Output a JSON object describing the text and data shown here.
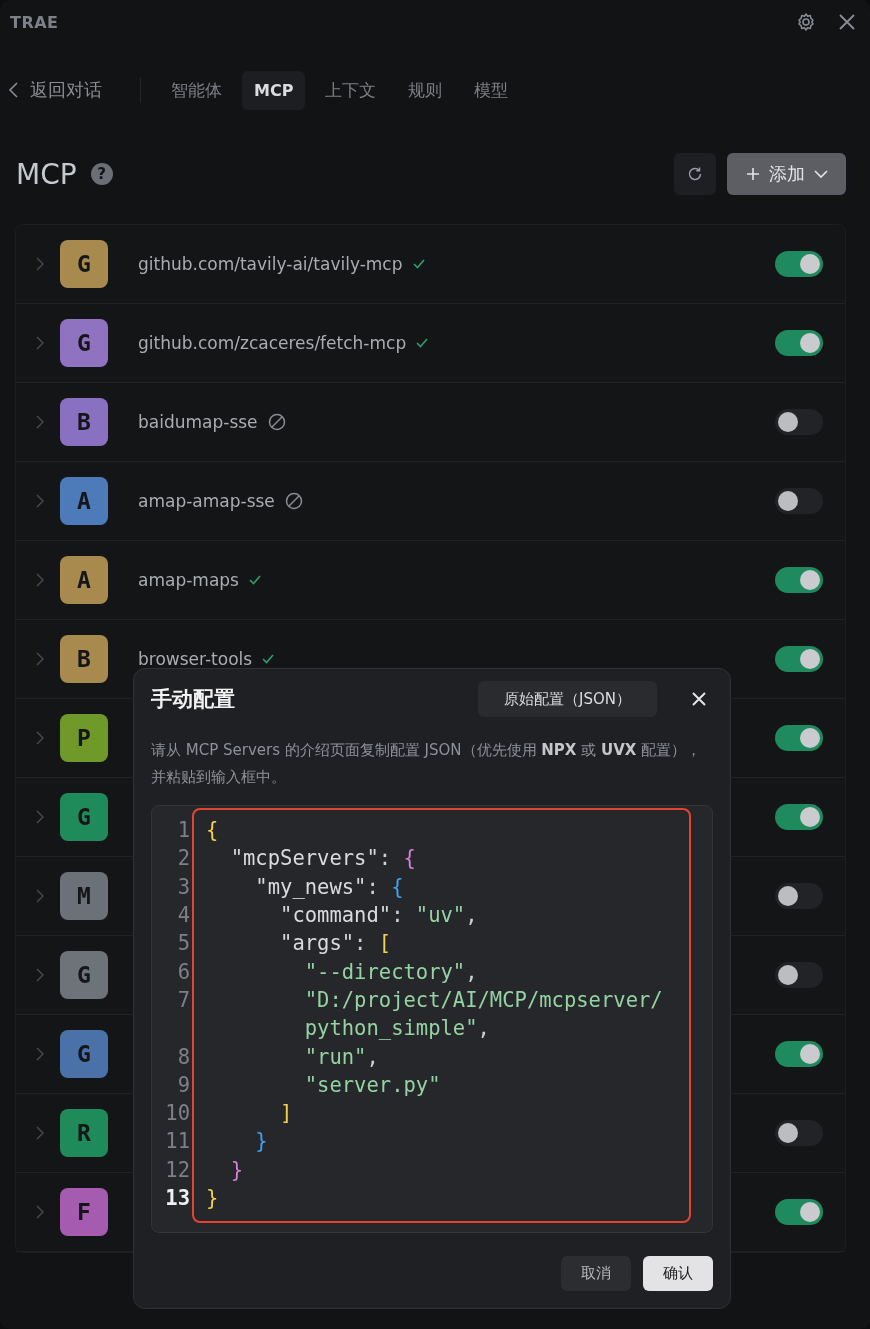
{
  "window": {
    "title": "TRAE"
  },
  "nav": {
    "back": "返回对话",
    "tabs": [
      {
        "label": "智能体",
        "selected": false
      },
      {
        "label": "MCP",
        "selected": true
      },
      {
        "label": "上下文",
        "selected": false
      },
      {
        "label": "规则",
        "selected": false
      },
      {
        "label": "模型",
        "selected": false
      }
    ]
  },
  "header": {
    "title": "MCP",
    "help": "?",
    "add_button": "添加"
  },
  "servers": [
    {
      "letter": "G",
      "color": "#a98a4e",
      "name": "github.com/tavily-ai/tavily-mcp",
      "verified": true,
      "on": true
    },
    {
      "letter": "G",
      "color": "#8f72c0",
      "name": "github.com/zcaceres/fetch-mcp",
      "verified": true,
      "on": true
    },
    {
      "letter": "B",
      "color": "#8a70c0",
      "name": "baidumap-sse",
      "verified": false,
      "on": false
    },
    {
      "letter": "A",
      "color": "#4d7ab8",
      "name": "amap-amap-sse",
      "verified": false,
      "on": false
    },
    {
      "letter": "A",
      "color": "#a98a4e",
      "name": "amap-maps",
      "verified": true,
      "on": true
    },
    {
      "letter": "B",
      "color": "#a98a4e",
      "name": "browser-tools",
      "verified": true,
      "on": true
    },
    {
      "letter": "P",
      "color": "#6f9a2a",
      "on": true
    },
    {
      "letter": "G",
      "color": "#1f8a5a",
      "on": true
    },
    {
      "letter": "M",
      "color": "#6c7078",
      "on": false
    },
    {
      "letter": "G",
      "color": "#6e7279",
      "on": false
    },
    {
      "letter": "G",
      "color": "#4a72a8",
      "on": true
    },
    {
      "letter": "R",
      "color": "#1f8a5a",
      "on": false
    },
    {
      "letter": "F",
      "color": "#a55cb0",
      "on": true
    }
  ],
  "dialog": {
    "title": "手动配置",
    "raw_button": "原始配置（JSON）",
    "description": "请从 MCP Servers 的介绍页面复制配置 JSON（优先使用 **NPX** 或 **UVX** 配置），并粘贴到输入框中。",
    "code": [
      {
        "number": "1",
        "active": false,
        "tokens": [
          {
            "t": "{",
            "kind": "bracket",
            "color": "#f2d24b"
          }
        ]
      },
      {
        "number": "2",
        "active": false,
        "tokens": [
          {
            "t": "  \"mcpServers\"",
            "kind": "key"
          },
          {
            "t": ": ",
            "kind": "punct"
          },
          {
            "t": "{",
            "kind": "bracket",
            "color": "#d67fd8"
          }
        ]
      },
      {
        "number": "3",
        "active": false,
        "tokens": [
          {
            "t": "    \"my_news\"",
            "kind": "key"
          },
          {
            "t": ": ",
            "kind": "punct"
          },
          {
            "t": "{",
            "kind": "bracket",
            "color": "#3ea3f4"
          }
        ]
      },
      {
        "number": "4",
        "active": false,
        "tokens": [
          {
            "t": "      \"command\"",
            "kind": "key"
          },
          {
            "t": ": ",
            "kind": "punct"
          },
          {
            "t": "\"uv\"",
            "kind": "string"
          },
          {
            "t": ",",
            "kind": "punct"
          }
        ]
      },
      {
        "number": "5",
        "active": false,
        "tokens": [
          {
            "t": "      \"args\"",
            "kind": "key"
          },
          {
            "t": ": ",
            "kind": "punct"
          },
          {
            "t": "[",
            "kind": "bracket",
            "color": "#f2d24b"
          }
        ]
      },
      {
        "number": "6",
        "active": false,
        "tokens": [
          {
            "t": "        \"--directory\"",
            "kind": "string"
          },
          {
            "t": ",",
            "kind": "punct"
          }
        ]
      },
      {
        "number": "7",
        "active": false,
        "tokens": [
          {
            "t": "        \"D:/project/AI/MCP/mcpserver/",
            "kind": "string"
          }
        ]
      },
      {
        "tokens": [
          {
            "t": "        python_simple\"",
            "kind": "string"
          },
          {
            "t": ",",
            "kind": "punct"
          }
        ]
      },
      {
        "number": "8",
        "active": false,
        "tokens": [
          {
            "t": "        \"run\"",
            "kind": "string"
          },
          {
            "t": ",",
            "kind": "punct"
          }
        ]
      },
      {
        "number": "9",
        "active": false,
        "tokens": [
          {
            "t": "        \"server.py\"",
            "kind": "string"
          }
        ]
      },
      {
        "number": "10",
        "active": false,
        "tokens": [
          {
            "t": "      ]",
            "kind": "bracket",
            "color": "#f2d24b"
          }
        ]
      },
      {
        "number": "11",
        "active": false,
        "tokens": [
          {
            "t": "    }",
            "kind": "bracket",
            "color": "#3ea3f4"
          }
        ]
      },
      {
        "number": "12",
        "active": false,
        "tokens": [
          {
            "t": "  }",
            "kind": "bracket",
            "color": "#d67fd8"
          }
        ]
      },
      {
        "number": "13",
        "active": true,
        "tokens": [
          {
            "t": "}",
            "kind": "bracket",
            "color": "#f2d24b"
          }
        ]
      }
    ],
    "buttons": [
      {
        "label": "取消",
        "kind": "secondary"
      },
      {
        "label": "确认",
        "kind": "primary"
      }
    ]
  }
}
